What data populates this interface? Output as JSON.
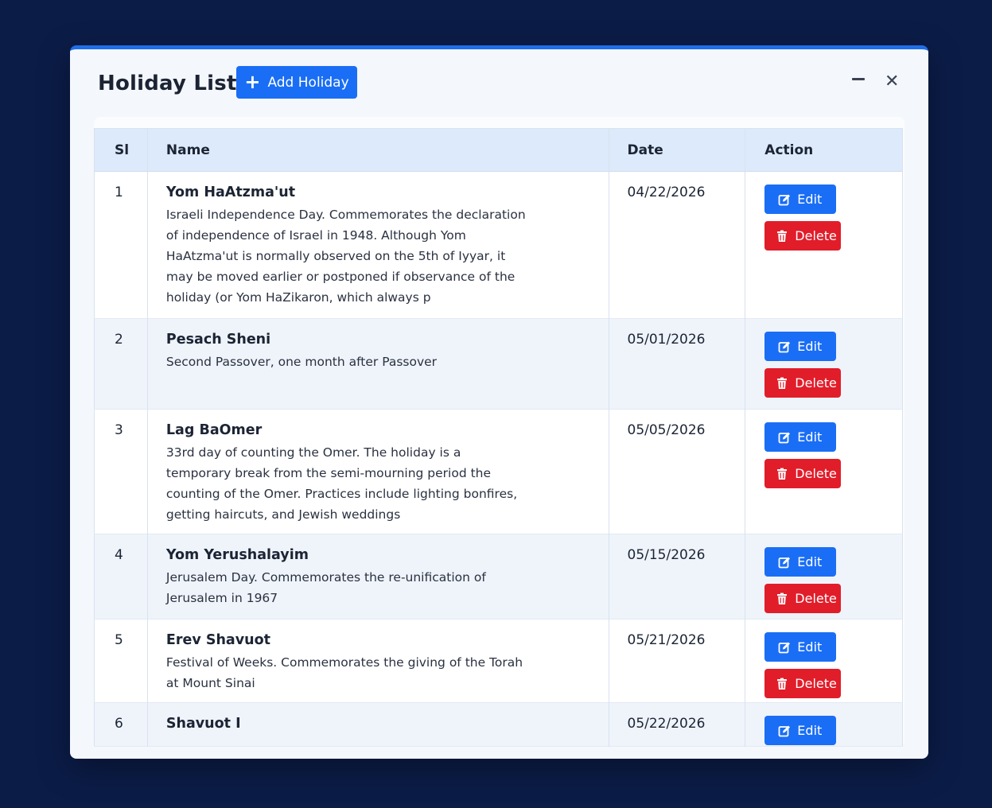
{
  "modal": {
    "title": "Holiday List",
    "add_button_label": "Add Holiday",
    "minimize_icon": "minimize-icon",
    "close_icon": "close-icon"
  },
  "colors": {
    "background": "#0b1c47",
    "primary": "#1a6ef5",
    "danger": "#e11d2a",
    "header_row": "#dceafb"
  },
  "table": {
    "headers": {
      "sl": "Sl",
      "name": "Name",
      "date": "Date",
      "action": "Action"
    },
    "edit_label": "Edit",
    "delete_label": "Delete",
    "rows": [
      {
        "sl": "1",
        "name": "Yom HaAtzma'ut",
        "description": "Israeli Independence Day. Commemorates the declaration of independence of Israel in 1948. Although Yom HaAtzma'ut is normally observed on the 5th of Iyyar, it may be moved earlier or postponed if observance of the holiday (or Yom HaZikaron, which always p",
        "date": "04/22/2026"
      },
      {
        "sl": "2",
        "name": "Pesach Sheni",
        "description": "Second Passover, one month after Passover",
        "date": "05/01/2026"
      },
      {
        "sl": "3",
        "name": "Lag BaOmer",
        "description": "33rd day of counting the Omer. The holiday is a temporary break from the semi-mourning period the counting of the Omer. Practices include lighting bonfires, getting haircuts, and Jewish weddings",
        "date": "05/05/2026"
      },
      {
        "sl": "4",
        "name": "Yom Yerushalayim",
        "description": "Jerusalem Day. Commemorates the re-unification of Jerusalem in 1967",
        "date": "05/15/2026"
      },
      {
        "sl": "5",
        "name": "Erev Shavuot",
        "description": "Festival of Weeks. Commemorates the giving of the Torah at Mount Sinai",
        "date": "05/21/2026"
      },
      {
        "sl": "6",
        "name": "Shavuot I",
        "description": "",
        "date": "05/22/2026"
      }
    ]
  }
}
